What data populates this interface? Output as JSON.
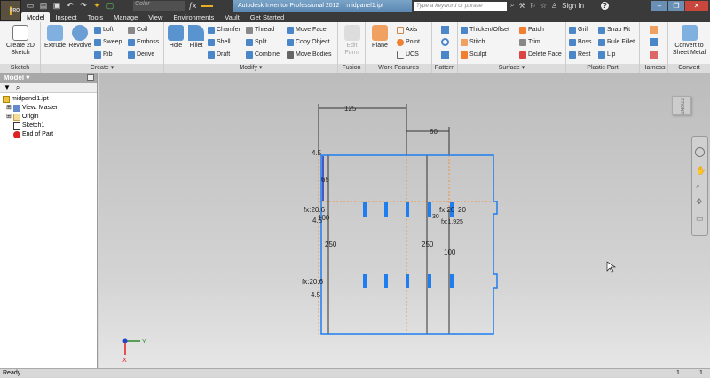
{
  "app": {
    "logo_text": "PRO",
    "title": "Autodesk Inventor Professional 2012",
    "document": "midpanel1.ipt",
    "color_select": "Color",
    "search_placeholder": "Type a keyword or phrase",
    "sign_in": "Sign In",
    "help": "?"
  },
  "tabs": [
    "Model",
    "Inspect",
    "Tools",
    "Manage",
    "View",
    "Environments",
    "Vault",
    "Get Started"
  ],
  "ribbon": {
    "sketch": {
      "label": "Sketch",
      "create_2d": "Create 2D Sketch"
    },
    "create": {
      "label": "Create ▾",
      "extrude": "Extrude",
      "revolve": "Revolve",
      "loft": "Loft",
      "sweep": "Sweep",
      "rib": "Rib",
      "coil": "Coil",
      "emboss": "Emboss",
      "derive": "Derive"
    },
    "modify": {
      "label": "Modify ▾",
      "hole": "Hole",
      "fillet": "Fillet",
      "chamfer": "Chamfer",
      "shell": "Shell",
      "draft": "Draft",
      "thread": "Thread",
      "split": "Split",
      "combine": "Combine",
      "move_face": "Move Face",
      "copy_object": "Copy Object",
      "move_bodies": "Move Bodies"
    },
    "fusion": {
      "label": "Fusion",
      "edit_form": "Edit Form"
    },
    "work_features": {
      "label": "Work Features",
      "plane": "Plane",
      "axis": "Axis",
      "point": "Point",
      "ucs": "UCS"
    },
    "pattern": {
      "label": "Pattern"
    },
    "surface": {
      "label": "Surface ▾",
      "thicken": "Thicken/Offset",
      "stitch": "Stitch",
      "sculpt": "Sculpt",
      "patch": "Patch",
      "trim": "Trim",
      "delete_face": "Delete Face"
    },
    "plastic": {
      "label": "Plastic Part",
      "grill": "Grill",
      "boss": "Boss",
      "rest": "Rest",
      "snap_fit": "Snap Fit",
      "rule_fillet": "Rule Fillet",
      "lip": "Lip"
    },
    "harness": {
      "label": "Harness"
    },
    "convert": {
      "label": "Convert",
      "convert_sheet": "Convert to Sheet Metal"
    }
  },
  "browser": {
    "title": "Model ▾",
    "items": [
      {
        "label": "midpanel1.ipt"
      },
      {
        "label": "View: Master"
      },
      {
        "label": "Origin"
      },
      {
        "label": "Sketch1"
      },
      {
        "label": "End of Part"
      }
    ]
  },
  "viewcube": {
    "face": "FRONT"
  },
  "sketch": {
    "dims": {
      "d125": "125",
      "d60": "60",
      "d45a": "4.5",
      "d65": "65",
      "fx1": "fx:20.6",
      "d100a": "100",
      "d45b": "4.5",
      "d250a": "250",
      "d250b": "250",
      "d100b": "100",
      "fx2": "fx:20.6",
      "d45c": "4.5",
      "fx3": "fx:20",
      "d20": "20",
      "d30": "30",
      "fx4": "fx:1.925"
    }
  },
  "axes": {
    "x": "X",
    "y": "Y"
  },
  "status": {
    "text": "Ready",
    "v1": "1",
    "v2": "1"
  },
  "colors": {
    "sketch_line": "#1e7ef0",
    "construction": "#f09040",
    "dimension": "#222222"
  }
}
